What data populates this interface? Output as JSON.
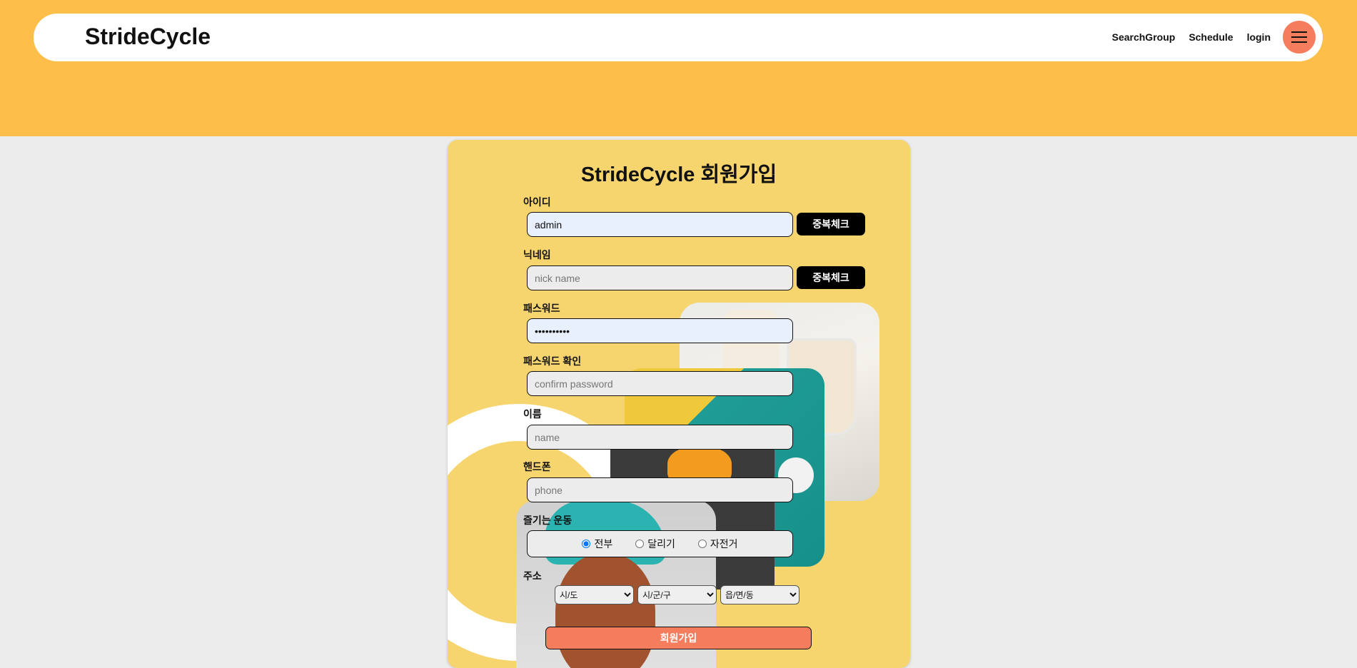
{
  "header": {
    "brand": "StrideCycle",
    "nav": [
      "SearchGroup",
      "Schedule",
      "login"
    ],
    "menu_icon": "hamburger-icon",
    "accent_color": "#f47d5d",
    "band_color": "#fdbf4a"
  },
  "form": {
    "title": "StrideCycle 회원가입",
    "id_label": "아이디",
    "id_value": "admin",
    "dup_check_label": "중복체크",
    "nickname_label": "닉네임",
    "nickname_placeholder": "nick name",
    "password_label": "패스워드",
    "password_value": "••••••••••",
    "confirm_label": "패스워드 확인",
    "confirm_placeholder": "confirm password",
    "name_label": "이름",
    "name_placeholder": "name",
    "phone_label": "핸드폰",
    "phone_placeholder": "phone",
    "sport_label": "즐기는 운동",
    "sport_options": [
      "전부",
      "달리기",
      "자전거"
    ],
    "sport_selected": "전부",
    "address_label": "주소",
    "address_selects": [
      "시/도",
      "시/군/구",
      "읍/면/동"
    ],
    "submit_label": "회원가입"
  }
}
